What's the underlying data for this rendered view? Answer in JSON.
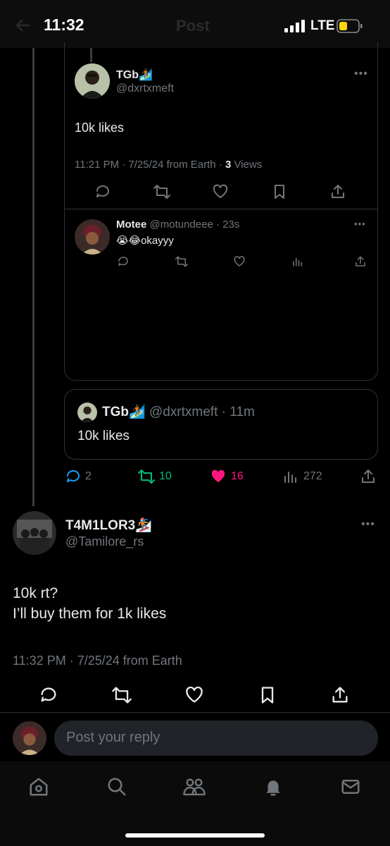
{
  "status_bar": {
    "time": "11:32",
    "network": "LTE",
    "faded_title": "Post"
  },
  "quoted_post": {
    "author_name": "TGb",
    "author_emoji": "🏄🏿",
    "handle": "@dxrtxmeft",
    "text": "10k likes",
    "meta_prefix": "11:21 PM · 7/25/24 from Earth · ",
    "views_count": "3",
    "views_label": " Views"
  },
  "nested_reply": {
    "author_name": "Motee",
    "handle": "@motundeee",
    "time": "· 23s",
    "emojis": "😭😂",
    "text": "okayyy"
  },
  "quote_card": {
    "author_name": "TGb",
    "author_emoji": "🏄🏿",
    "handle": "@dxrtxmeft",
    "time": "· 11m",
    "text": "10k likes"
  },
  "engagement": {
    "replies": "2",
    "reposts": "10",
    "likes": "16",
    "views": "272"
  },
  "main_post": {
    "author_name": "T4M1LOR3",
    "author_emoji": "🏂🏿",
    "handle": "@Tamilore_rs",
    "text_line1": "10k rt?",
    "text_line2": "I’ll buy them for 1k likes",
    "meta": "11:32 PM · 7/25/24 from Earth"
  },
  "reply_bar": {
    "placeholder": "Post your reply"
  },
  "colors": {
    "background": "#000000",
    "text": "#e7e9ea",
    "muted": "#71767b",
    "repost_green": "#00ba7c",
    "like_pink": "#f91880",
    "border": "#2f3336"
  },
  "icons": [
    "reply-icon",
    "repost-icon",
    "like-icon",
    "bookmark-icon",
    "share-icon",
    "views-icon",
    "home-icon",
    "search-icon",
    "communities-icon",
    "notifications-icon",
    "messages-icon"
  ]
}
